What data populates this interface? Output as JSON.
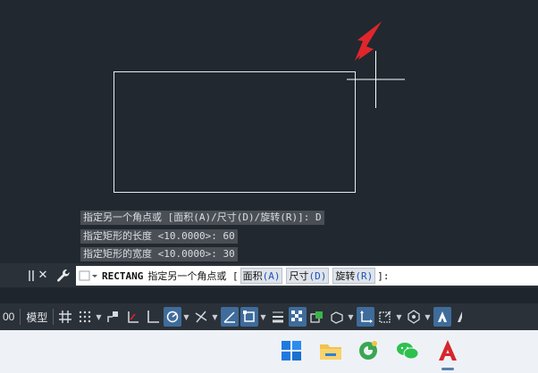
{
  "history": [
    "指定另一个角点或 [面积(A)/尺寸(D)/旋转(R)]: D",
    "指定矩形的长度 <10.0000>: 60",
    "指定矩形的宽度 <10.0000>: 30"
  ],
  "command_line": {
    "command": "RECTANG",
    "prompt": "指定另一个角点或 [",
    "options": [
      {
        "label": "面积",
        "key": "(A)"
      },
      {
        "label": "尺寸",
        "key": "(D)"
      },
      {
        "label": "旋转",
        "key": "(R)"
      }
    ],
    "suffix": "]:"
  },
  "status_bar": {
    "left_text": "00",
    "model_label": "模型"
  },
  "colors": {
    "canvas_bg": "#212830",
    "annotation_arrow": "#e0262b",
    "active_toggle": "#3f6c9b"
  },
  "taskbar": {
    "apps": [
      "start-icon",
      "file-explorer-icon",
      "browser-icon",
      "wechat-icon",
      "autocad-icon"
    ]
  }
}
